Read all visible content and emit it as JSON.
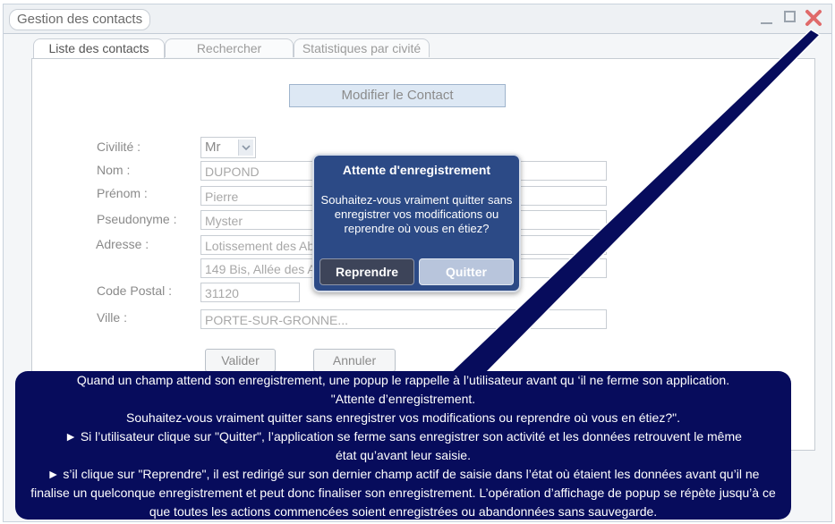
{
  "window": {
    "title": "Gestion des contacts"
  },
  "tabs": [
    {
      "label": "Liste des contacts"
    },
    {
      "label": "Rechercher"
    },
    {
      "label": "Statistiques par civité"
    }
  ],
  "form": {
    "title": "Modifier le Contact",
    "labels": {
      "civilite": "Civilité :",
      "nom": "Nom :",
      "prenom": "Prénom :",
      "pseudonyme": "Pseudonyme :",
      "adresse": "Adresse :",
      "code_postal": "Code Postal :",
      "ville": "Ville :"
    },
    "values": {
      "civilite": "Mr",
      "nom": "DUPOND",
      "prenom": "Pierre",
      "pseudonyme": "Myster",
      "adresse1": "Lotissement des Abeilles",
      "adresse2": "149 Bis, Allée des Abeilles",
      "code_postal": "31120",
      "ville": "PORTE-SUR-GRONNE..."
    },
    "buttons": {
      "valider": "Valider",
      "annuler": "Annuler"
    }
  },
  "popup": {
    "title": "Attente d'enregistrement",
    "message": "Souhaitez-vous vraiment quitter sans enregistrer vos modifications ou reprendre où vous en étiez?",
    "reprendre": "Reprendre",
    "quitter": "Quitter"
  },
  "callout": {
    "lines": [
      "Quand un champ attend son enregistrement, une popup le rappelle à l’utilisateur avant qu ‘il ne ferme son application.",
      "\"Attente d’enregistrement.",
      "Souhaitez-vous vraiment quitter sans enregistrer vos modifications ou reprendre où vous en étiez?\".",
      "► Si l’utilisateur clique sur \"Quitter\", l’application se ferme sans enregistrer son activité et les données retrouvent le même état qu’avant leur saisie.",
      "► s’il clique sur \"Reprendre\", il est redirigé sur son dernier champ actif de saisie dans l’état où étaient les données avant qu’il ne finalise un quelconque enregistrement et peut donc finaliser son enregistrement. L’opération d’affichage de popup se répète jusqu’à ce que toutes les actions commencées soient enregistrées ou abandonnées sans sauvegarde."
    ]
  },
  "colors": {
    "popup_bg": "#2c4a86",
    "callout_bg": "#070c5c",
    "close_x": "#e06a6a"
  },
  "icons": {
    "close": "close-icon",
    "minimize": "minimize-icon",
    "maximize": "maximize-icon",
    "dropdown": "chevron-down-icon"
  }
}
